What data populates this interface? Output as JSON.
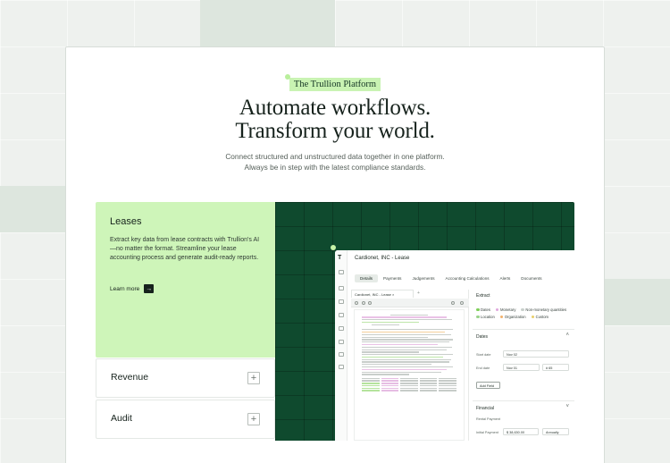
{
  "hero": {
    "badge": "The Trullion Platform",
    "headline_line1": "Automate workflows.",
    "headline_line2": "Transform your world.",
    "subtext_line1": "Connect structured and unstructured data together in one platform.",
    "subtext_line2": "Always be in step with the latest compliance standards."
  },
  "accordion": {
    "active": {
      "title": "Leases",
      "description": "Extract key data from lease contracts with Trullion's AI—no matter the format. Streamline your lease accounting process and generate audit-ready reports.",
      "link": "Learn more"
    },
    "items": [
      {
        "label": "Revenue",
        "icon": "plus-icon"
      },
      {
        "label": "Audit",
        "icon": "plus-icon"
      }
    ]
  },
  "app": {
    "title": "Cardionet, INC - Lease",
    "tabs": [
      "Details",
      "Payments",
      "Judgements",
      "Accounting Calculations",
      "Alerts",
      "Documents"
    ],
    "active_tab": "Details",
    "document_tab": "Cardionet, INC - Lease",
    "extract": {
      "heading": "Extract",
      "chips": [
        {
          "label": "Dates",
          "color": "#7fcf5a"
        },
        {
          "label": "Monetary",
          "color": "#e0a6dc"
        },
        {
          "label": "Non-monetary quantities",
          "color": "#c9d0cc"
        },
        {
          "label": "Location",
          "color": "#9ad28b"
        },
        {
          "label": "Organization",
          "color": "#f2b16b"
        },
        {
          "label": "Custom",
          "color": "#e8cf6a"
        }
      ]
    },
    "dates": {
      "heading": "Dates",
      "start_label": "Start date",
      "start_value": "Nov 02",
      "end_label": "End date",
      "end_value": "Nov 01",
      "term_value": "# 65",
      "add_field": "Add Field"
    },
    "financial": {
      "heading": "Financial",
      "sub": "Rental Payment",
      "initial_label": "Initial Payment",
      "initial_value": "$ 38,630.00",
      "frequency": "Annually"
    }
  },
  "colors": {
    "accent_green": "#cef5b9",
    "panel_dark": "#0f4a2e"
  }
}
